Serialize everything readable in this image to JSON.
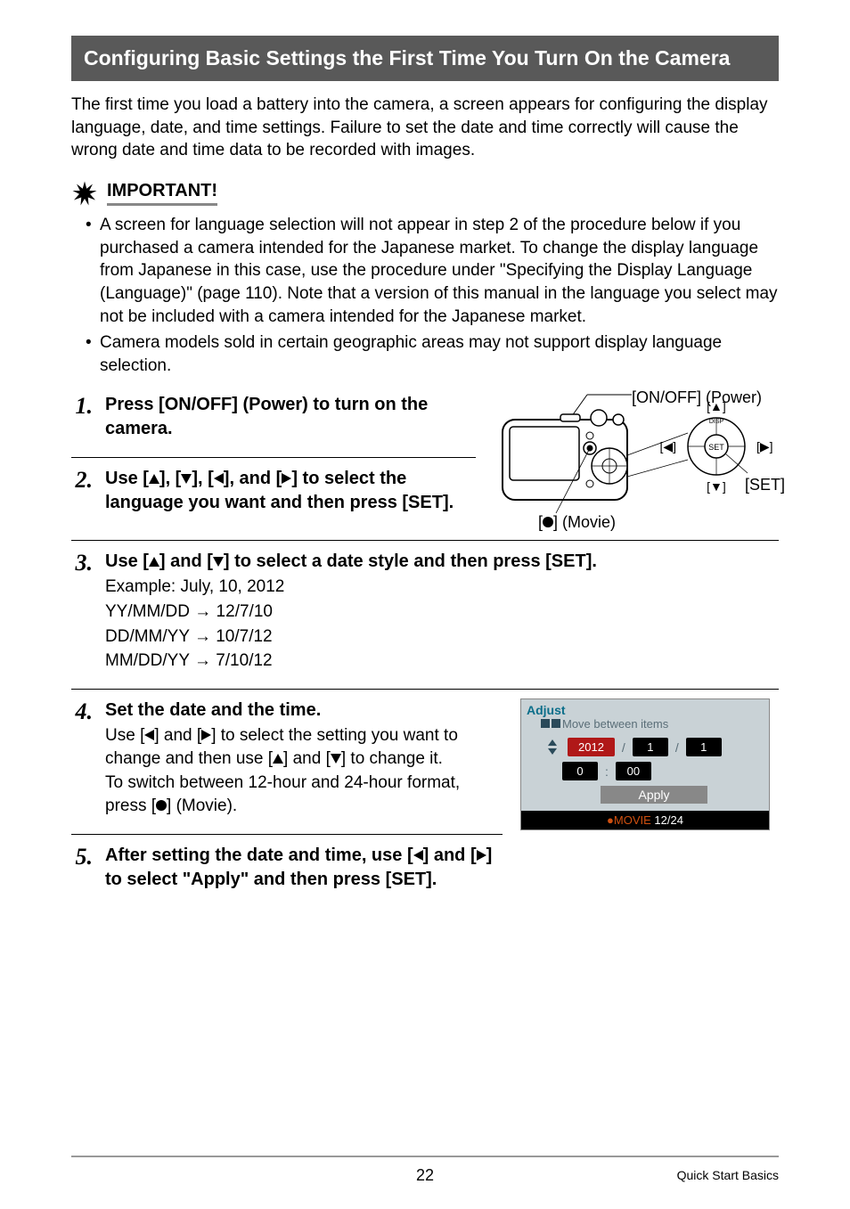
{
  "header": {
    "title": "Configuring Basic Settings the First Time You Turn On the Camera"
  },
  "intro": "The first time you load a battery into the camera, a screen appears for configuring the display language, date, and time settings. Failure to set the date and time correctly will cause the wrong date and time data to be recorded with images.",
  "important": {
    "label": "IMPORTANT!",
    "bullets": [
      "A screen for language selection will not appear in step 2 of the procedure below if you purchased a camera intended for the Japanese market. To change the display language from Japanese in this case, use the procedure under \"Specifying the Display Language (Language)\" (page 110). Note that a version of this manual in the language you select may not be included with a camera intended for the Japanese market.",
      "Camera models sold in certain geographic areas may not support display language selection."
    ]
  },
  "diagram": {
    "power_label": "[ON/OFF] (Power)",
    "movie_label": "] (Movie)",
    "set_label": "[SET]"
  },
  "steps": {
    "s1": {
      "num": "1.",
      "title": "Press [ON/OFF] (Power) to turn on the camera."
    },
    "s2": {
      "num": "2.",
      "title_a": "Use [",
      "title_b": "], [",
      "title_c": "], [",
      "title_d": "], and [",
      "title_e": "] to select the language you want and then press [SET]."
    },
    "s3": {
      "num": "3.",
      "title_a": "Use [",
      "title_b": "] and [",
      "title_c": "] to select a date style and then press [SET].",
      "example": "Example: July, 10, 2012",
      "f1_a": "YY/MM/DD ",
      "f1_b": " 12/7/10",
      "f2_a": "DD/MM/YY ",
      "f2_b": " 10/7/12",
      "f3_a": "MM/DD/YY ",
      "f3_b": " 7/10/12"
    },
    "s4": {
      "num": "4.",
      "title": "Set the date and the time.",
      "l1_a": "Use [",
      "l1_b": "] and [",
      "l1_c": "] to select the setting you want to change and then use [",
      "l1_d": "] and [",
      "l1_e": "] to change it.",
      "l2_a": "To switch between 12-hour and 24-hour format, press [",
      "l2_b": "] (Movie)."
    },
    "s5": {
      "num": "5.",
      "title_a": "After setting the date and time, use [",
      "title_b": "] and [",
      "title_c": "] to select \"Apply\" and then press [SET]."
    }
  },
  "adjust_screen": {
    "title": "Adjust",
    "sub": "Move between items",
    "year": "2012",
    "month": "1",
    "day": "1",
    "hour": "0",
    "min": "00",
    "apply": "Apply",
    "footer_a": "MOVIE",
    "footer_b": " 12/24"
  },
  "footer": {
    "page": "22",
    "section": "Quick Start Basics"
  }
}
